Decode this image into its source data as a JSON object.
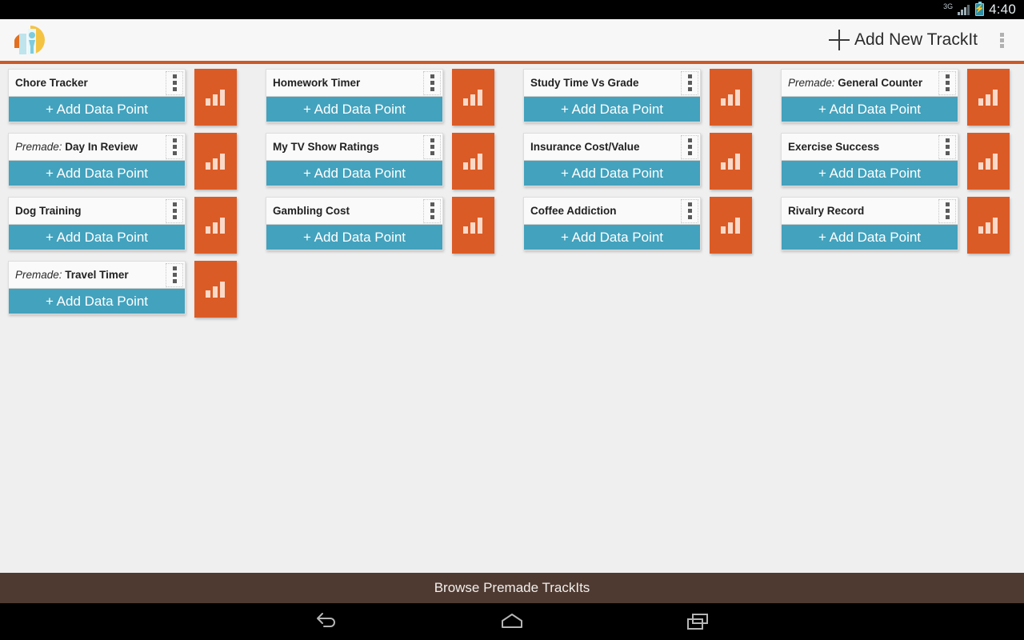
{
  "statusbar": {
    "network_label": "3G",
    "signal_icon": "signal-bars-icon",
    "battery_icon": "battery-charging-icon",
    "time": "4:40"
  },
  "appbar": {
    "logo_icon": "trackit-logo-icon",
    "plus_icon": "plus-icon",
    "add_new_label": "Add New TrackIt",
    "overflow_icon": "overflow-menu-icon"
  },
  "colors": {
    "accent_orange": "#db5b26",
    "divider_orange": "#cb5a28",
    "button_teal": "#43a2bd",
    "bottom_bar_brown": "#4e3a31",
    "page_background": "#efefef",
    "card_background": "#fafafa"
  },
  "card_defaults": {
    "add_data_point_label": "+ Add Data Point",
    "premade_prefix": "Premade:",
    "overflow_icon": "overflow-menu-icon",
    "chart_icon": "bar-chart-icon"
  },
  "cards": [
    {
      "title": "Chore Tracker",
      "premade": false
    },
    {
      "title": "Homework Timer",
      "premade": false
    },
    {
      "title": "Study Time Vs Grade",
      "premade": false
    },
    {
      "title": "General Counter",
      "premade": true
    },
    {
      "title": "Day In Review",
      "premade": true
    },
    {
      "title": "My TV Show Ratings",
      "premade": false
    },
    {
      "title": "Insurance Cost/Value",
      "premade": false
    },
    {
      "title": "Exercise Success",
      "premade": false
    },
    {
      "title": "Dog Training",
      "premade": false
    },
    {
      "title": "Gambling Cost",
      "premade": false
    },
    {
      "title": "Coffee Addiction",
      "premade": false
    },
    {
      "title": "Rivalry Record",
      "premade": false
    },
    {
      "title": "Travel Timer",
      "premade": true
    }
  ],
  "bottom_bar": {
    "browse_label": "Browse Premade TrackIts"
  },
  "navbar": {
    "back_icon": "back-arrow-icon",
    "home_icon": "home-icon",
    "recents_icon": "recent-apps-icon"
  }
}
